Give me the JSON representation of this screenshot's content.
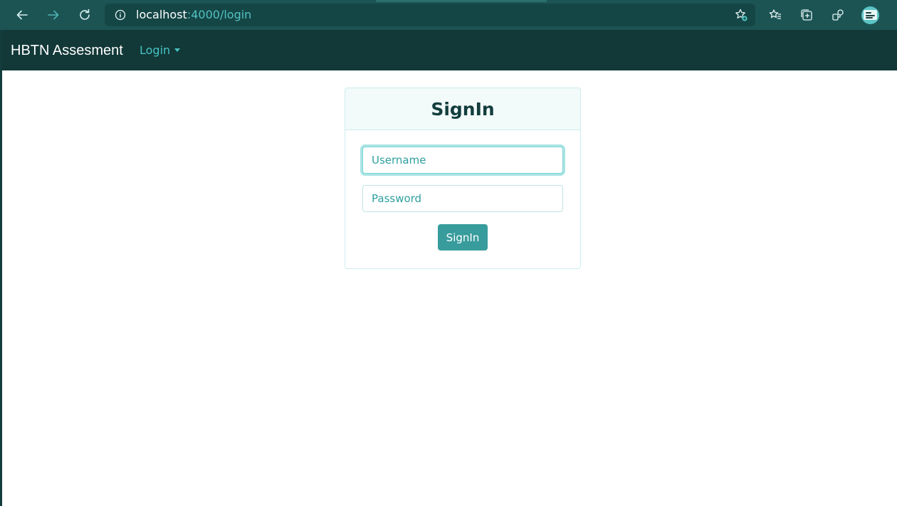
{
  "browser": {
    "url_host": "localhost",
    "url_rest": ":4000/login",
    "icons": {
      "back": "back-arrow-icon",
      "forward": "forward-arrow-icon",
      "reload": "reload-icon",
      "info": "site-info-icon",
      "add_favorite": "add-favorite-icon",
      "favorites": "favorites-icon",
      "collections": "collections-icon",
      "extensions": "extensions-icon",
      "profile": "profile-avatar"
    }
  },
  "navbar": {
    "brand": "HBTN Assesment",
    "dropdown_label": "Login"
  },
  "signin": {
    "title": "SignIn",
    "username_placeholder": "Username",
    "password_placeholder": "Password",
    "submit_label": "SignIn"
  },
  "colors": {
    "chrome": "#1c5454",
    "navbar": "#123838",
    "accent": "#389c9c",
    "link": "#48c3c3"
  }
}
